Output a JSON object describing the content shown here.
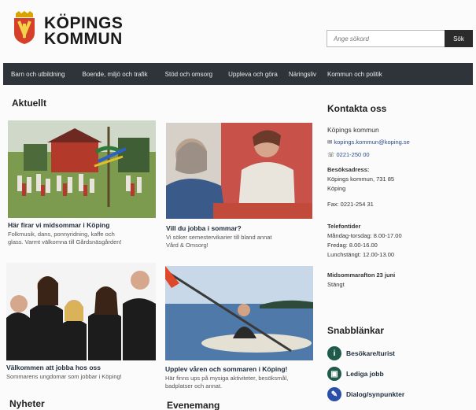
{
  "header": {
    "site_name_line1": "KÖPINGS",
    "site_name_line2": "KOMMUN",
    "search_placeholder": "Ange sökord",
    "search_button": "Sök"
  },
  "nav": {
    "items": [
      "Barn och utbildning",
      "Boende, miljö och trafik",
      "Stöd och omsorg",
      "Uppleva och göra",
      "Näringsliv",
      "Kommun och politik"
    ]
  },
  "news": {
    "heading": "Aktuellt",
    "cards": [
      {
        "title": "Här firar vi midsommar i Köping",
        "text_line1": "Folkmusik, dans, ponnyridning, kaffe och",
        "text_line2": "glass. Varmt välkomna till Gårdsnäsgården!"
      },
      {
        "title": "Vill du jobba i sommar?",
        "text_line1": "Vi söker semestervikarier till bland annat",
        "text_line2": "Vård & Omsorg!"
      },
      {
        "title": "Välkommen att jobba hos oss",
        "text_line1": "Sommarens ungdomar som jobbar i Köping!",
        "text_line2": ""
      },
      {
        "title": "Upplev våren och sommaren i Köping!",
        "text_line1": "Här finns ups på mysiga aktiviteter, besöksmål,",
        "text_line2": "badplatser och annat."
      }
    ]
  },
  "contact": {
    "heading": "Kontakta oss",
    "org": "Köpings kommun",
    "email": "kopings.kommun@koping.se",
    "phone": "0221-250 00",
    "address_label": "Besöksadress:",
    "address_line1": "Köpings kommun, 731 85",
    "address_line2": "Köping",
    "fax": "Fax: 0221-254 31",
    "hours_label": "Telefontider",
    "hours_line1": "Måndag-torsdag: 8.00-17.00",
    "hours_line2": "Fredag: 8.00-16.00",
    "hours_line3": "Lunchstängt: 12.00-13.00",
    "note_line1": "Midsommarafton 23 juni",
    "note_line2": "Stängt"
  },
  "quick_links": {
    "heading": "Snabblänkar",
    "items": [
      {
        "label": "Besökare/turist",
        "icon": "info-icon"
      },
      {
        "label": "Lediga jobb",
        "icon": "briefcase-icon"
      },
      {
        "label": "Dialog/synpunkter",
        "icon": "speech-icon"
      }
    ]
  },
  "bottom": {
    "nyheter": "Nyheter",
    "evenemang": "Evenemang"
  },
  "colors": {
    "nav_bg": "#2e343a",
    "quick_icon_bg": "#1f5a4a"
  }
}
